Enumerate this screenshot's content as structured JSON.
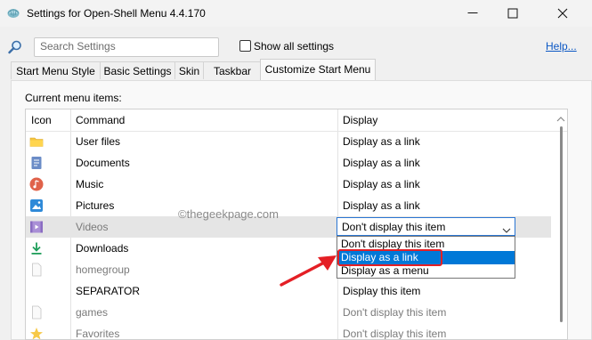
{
  "window": {
    "title": "Settings for Open-Shell Menu 4.4.170"
  },
  "toolbar": {
    "search_placeholder": "Search Settings",
    "show_all_label": "Show all settings",
    "show_all_checked": false,
    "help_label": "Help..."
  },
  "tabs": [
    {
      "label": "Start Menu Style",
      "active": false
    },
    {
      "label": "Basic Settings",
      "active": false
    },
    {
      "label": "Skin",
      "active": false
    },
    {
      "label": "Taskbar",
      "active": false
    },
    {
      "label": "Customize Start Menu",
      "active": true
    }
  ],
  "panel": {
    "section_label": "Current menu items:"
  },
  "list": {
    "columns": [
      "Icon",
      "Command",
      "Display"
    ],
    "rows": [
      {
        "icon": "folder-icon",
        "command": "User files",
        "display": "Display as a link"
      },
      {
        "icon": "documents-icon",
        "command": "Documents",
        "display": "Display as a link"
      },
      {
        "icon": "music-icon",
        "command": "Music",
        "display": "Display as a link"
      },
      {
        "icon": "pictures-icon",
        "command": "Pictures",
        "display": "Display as a link"
      },
      {
        "icon": "videos-icon",
        "command": "Videos",
        "display": "Don't display this item",
        "selected": true
      },
      {
        "icon": "downloads-icon",
        "command": "Downloads",
        "display": ""
      },
      {
        "icon": "blank-page-icon",
        "command": "homegroup",
        "display": ""
      },
      {
        "icon": "",
        "command": "SEPARATOR",
        "display": "Display this item"
      },
      {
        "icon": "blank-page-icon",
        "command": "games",
        "display": "Don't display this item"
      },
      {
        "icon": "star-icon",
        "command": "Favorites",
        "display": "Don't display this item"
      }
    ]
  },
  "display_combo": {
    "value": "Don't display this item",
    "options": [
      "Don't display this item",
      "Display as a link",
      "Display as a menu"
    ],
    "highlighted": "Display as a link"
  },
  "watermark": "©thegeekpage.com",
  "colors": {
    "accent": "#0078d7",
    "annotation_red": "#e41f25",
    "link": "#0b57c4"
  }
}
